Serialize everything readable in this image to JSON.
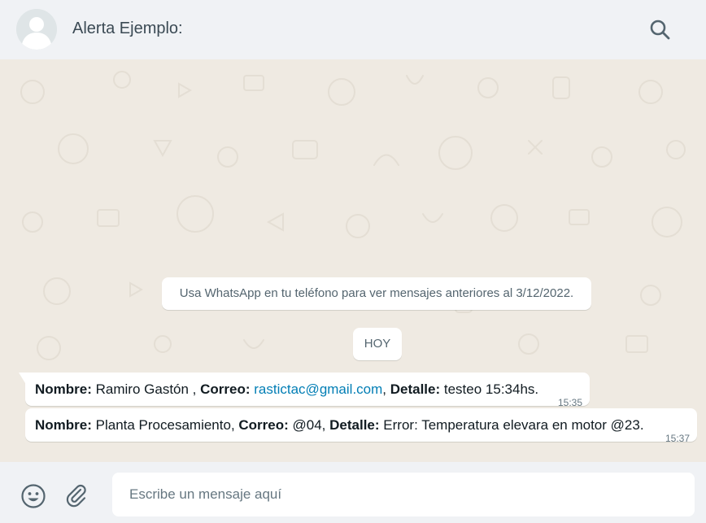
{
  "header": {
    "contact_name": "Alerta Ejemplo:",
    "avatar_icon": "default-user-avatar-icon",
    "search_icon": "search-icon"
  },
  "chat": {
    "notice": "Usa WhatsApp en tu teléfono para ver mensajes anteriores al 3/12/2022.",
    "date_chip": "HOY",
    "messages": [
      {
        "label1": "Nombre:",
        "value1": " Ramiro Gastón , ",
        "label2": "Correo:",
        "link": "rastictac@gmail.com",
        "sep": ", ",
        "label3": "Detalle:",
        "value3": " testeo 15:34hs.",
        "time": "15:35"
      },
      {
        "label1": "Nombre:",
        "value1": " Planta Procesamiento, ",
        "label2": "Correo:",
        "value2": " @04, ",
        "label3": "Detalle:",
        "value3": " Error: Temperatura elevara en motor @23.",
        "time": "15:37"
      }
    ]
  },
  "footer": {
    "input_placeholder": "Escribe un mensaje aquí",
    "emoji_icon": "emoji-icon",
    "attach_icon": "paperclip-icon"
  },
  "colors": {
    "header_bg": "#f0f2f5",
    "chat_bg": "#efeae2",
    "bubble_bg": "#ffffff",
    "link": "#027eb5",
    "meta_text": "#667781"
  }
}
